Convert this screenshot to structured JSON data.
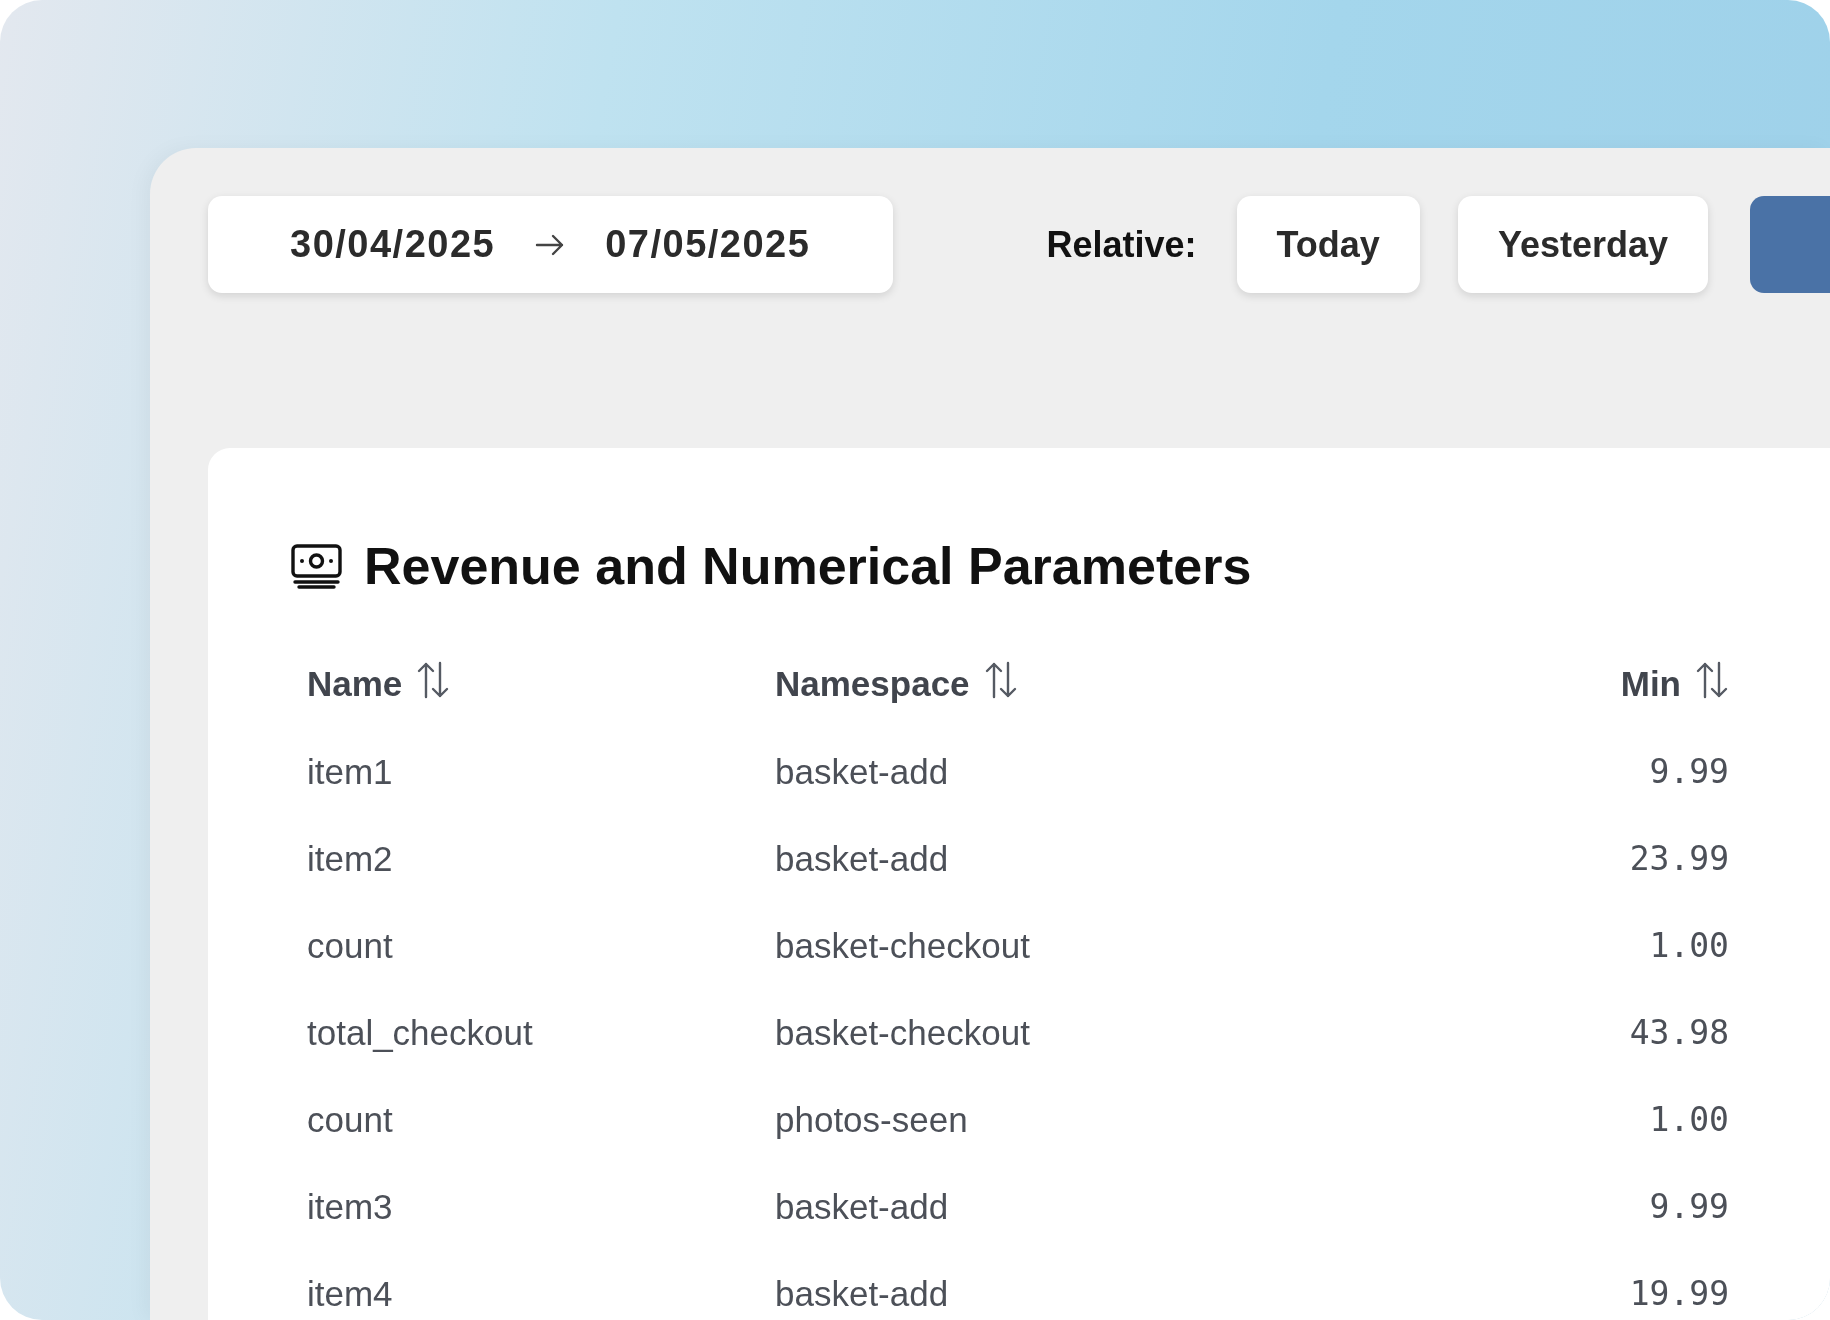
{
  "date_range": {
    "start": "30/04/2025",
    "end": "07/05/2025"
  },
  "relative": {
    "label": "Relative:",
    "options": [
      "Today",
      "Yesterday"
    ]
  },
  "section": {
    "title": "Revenue and Numerical Parameters",
    "columns": [
      {
        "label": "Name",
        "kind": "text",
        "sortable": true
      },
      {
        "label": "Namespace",
        "kind": "text",
        "sortable": true
      },
      {
        "label": "Min",
        "kind": "number",
        "sortable": true
      }
    ],
    "rows": [
      [
        "item1",
        "basket-add",
        "9.99"
      ],
      [
        "item2",
        "basket-add",
        "23.99"
      ],
      [
        "count",
        "basket-checkout",
        "1.00"
      ],
      [
        "total_checkout",
        "basket-checkout",
        "43.98"
      ],
      [
        "count",
        "photos-seen",
        "1.00"
      ],
      [
        "item3",
        "basket-add",
        "9.99"
      ],
      [
        "item4",
        "basket-add",
        "19.99"
      ]
    ]
  }
}
